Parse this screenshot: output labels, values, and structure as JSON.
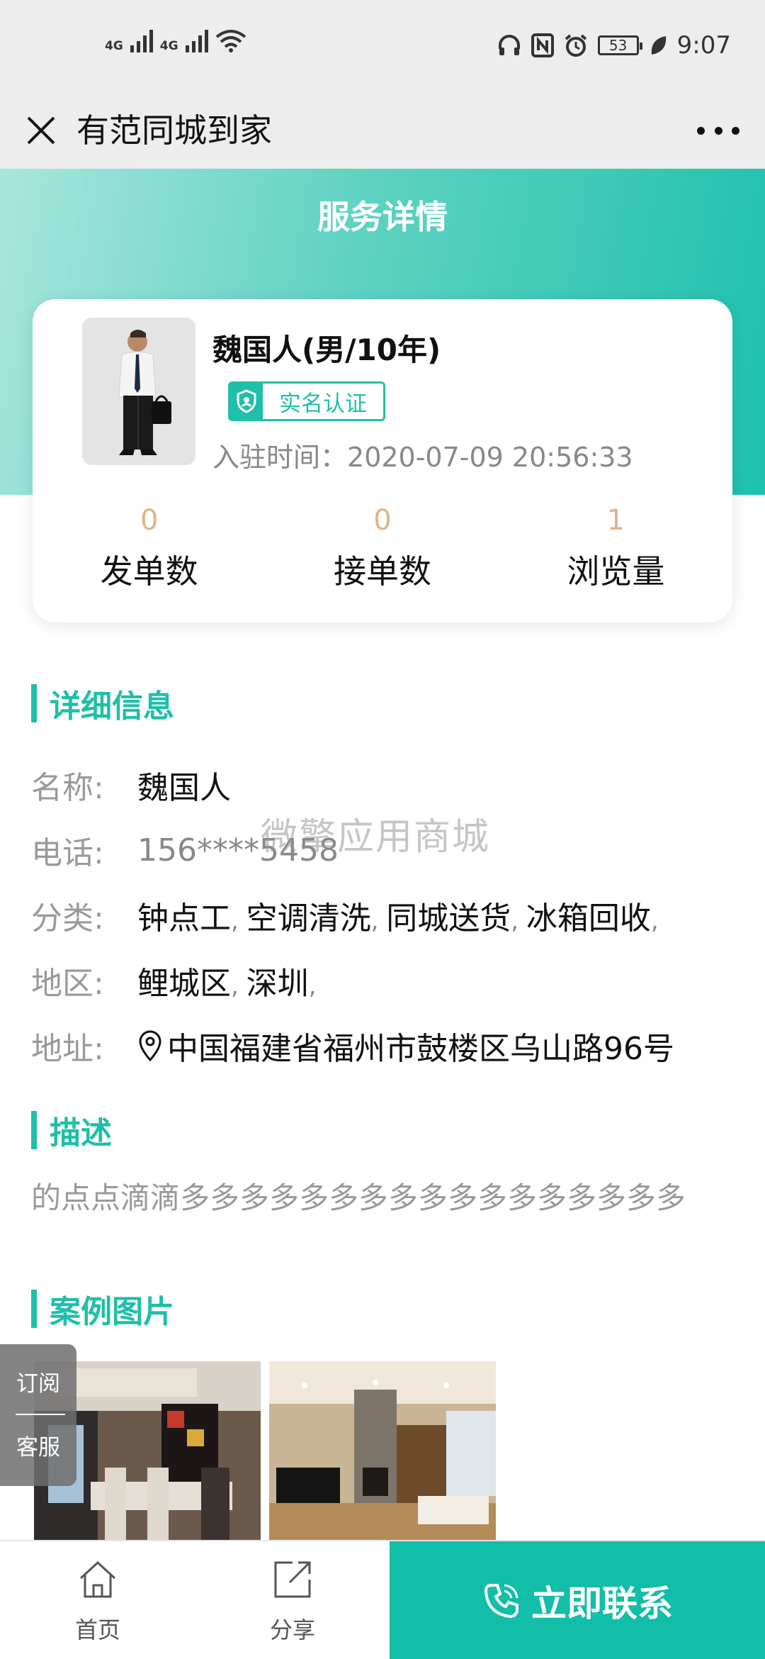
{
  "status_bar": {
    "network_1": "4G",
    "network_2": "4G",
    "battery": "53",
    "time": "9:07"
  },
  "nav": {
    "title": "有范同城到家"
  },
  "header": {
    "title": "服务详情",
    "gradient_start": "#a8e6dc",
    "gradient_end": "#1ec1ad"
  },
  "profile": {
    "name": "魏国人(男/10年)",
    "badge": "实名认证",
    "join_label": "入驻时间：",
    "join_time": "2020-07-09 20:56:33"
  },
  "stats": [
    {
      "value": "0",
      "label": "发单数"
    },
    {
      "value": "0",
      "label": "接单数"
    },
    {
      "value": "1",
      "label": "浏览量"
    }
  ],
  "details": {
    "title": "详细信息",
    "name_label": "名称:",
    "name_value": "魏国人",
    "phone_label": "电话:",
    "phone_value": "156****5458",
    "category_label": "分类:",
    "categories": [
      "钟点工",
      "空调清洗",
      "同城送货",
      "冰箱回收"
    ],
    "region_label": "地区:",
    "regions": [
      "鲤城区",
      "深圳"
    ],
    "address_label": "地址:",
    "address_value": "中国福建省福州市鼓楼区乌山路96号"
  },
  "watermark": "微擎应用商城",
  "description": {
    "title": "描述",
    "text": "的点点滴滴多多多多多多多多多多多多多多多多多"
  },
  "cases": {
    "title": "案例图片"
  },
  "side_tab": {
    "subscribe": "订阅",
    "service": "客服"
  },
  "bottom_bar": {
    "home": "首页",
    "share": "分享",
    "contact": "立即联系"
  },
  "colors": {
    "accent": "#1fbfa9",
    "contact_button": "#12bea8",
    "stat_number": "#e0b48a"
  }
}
